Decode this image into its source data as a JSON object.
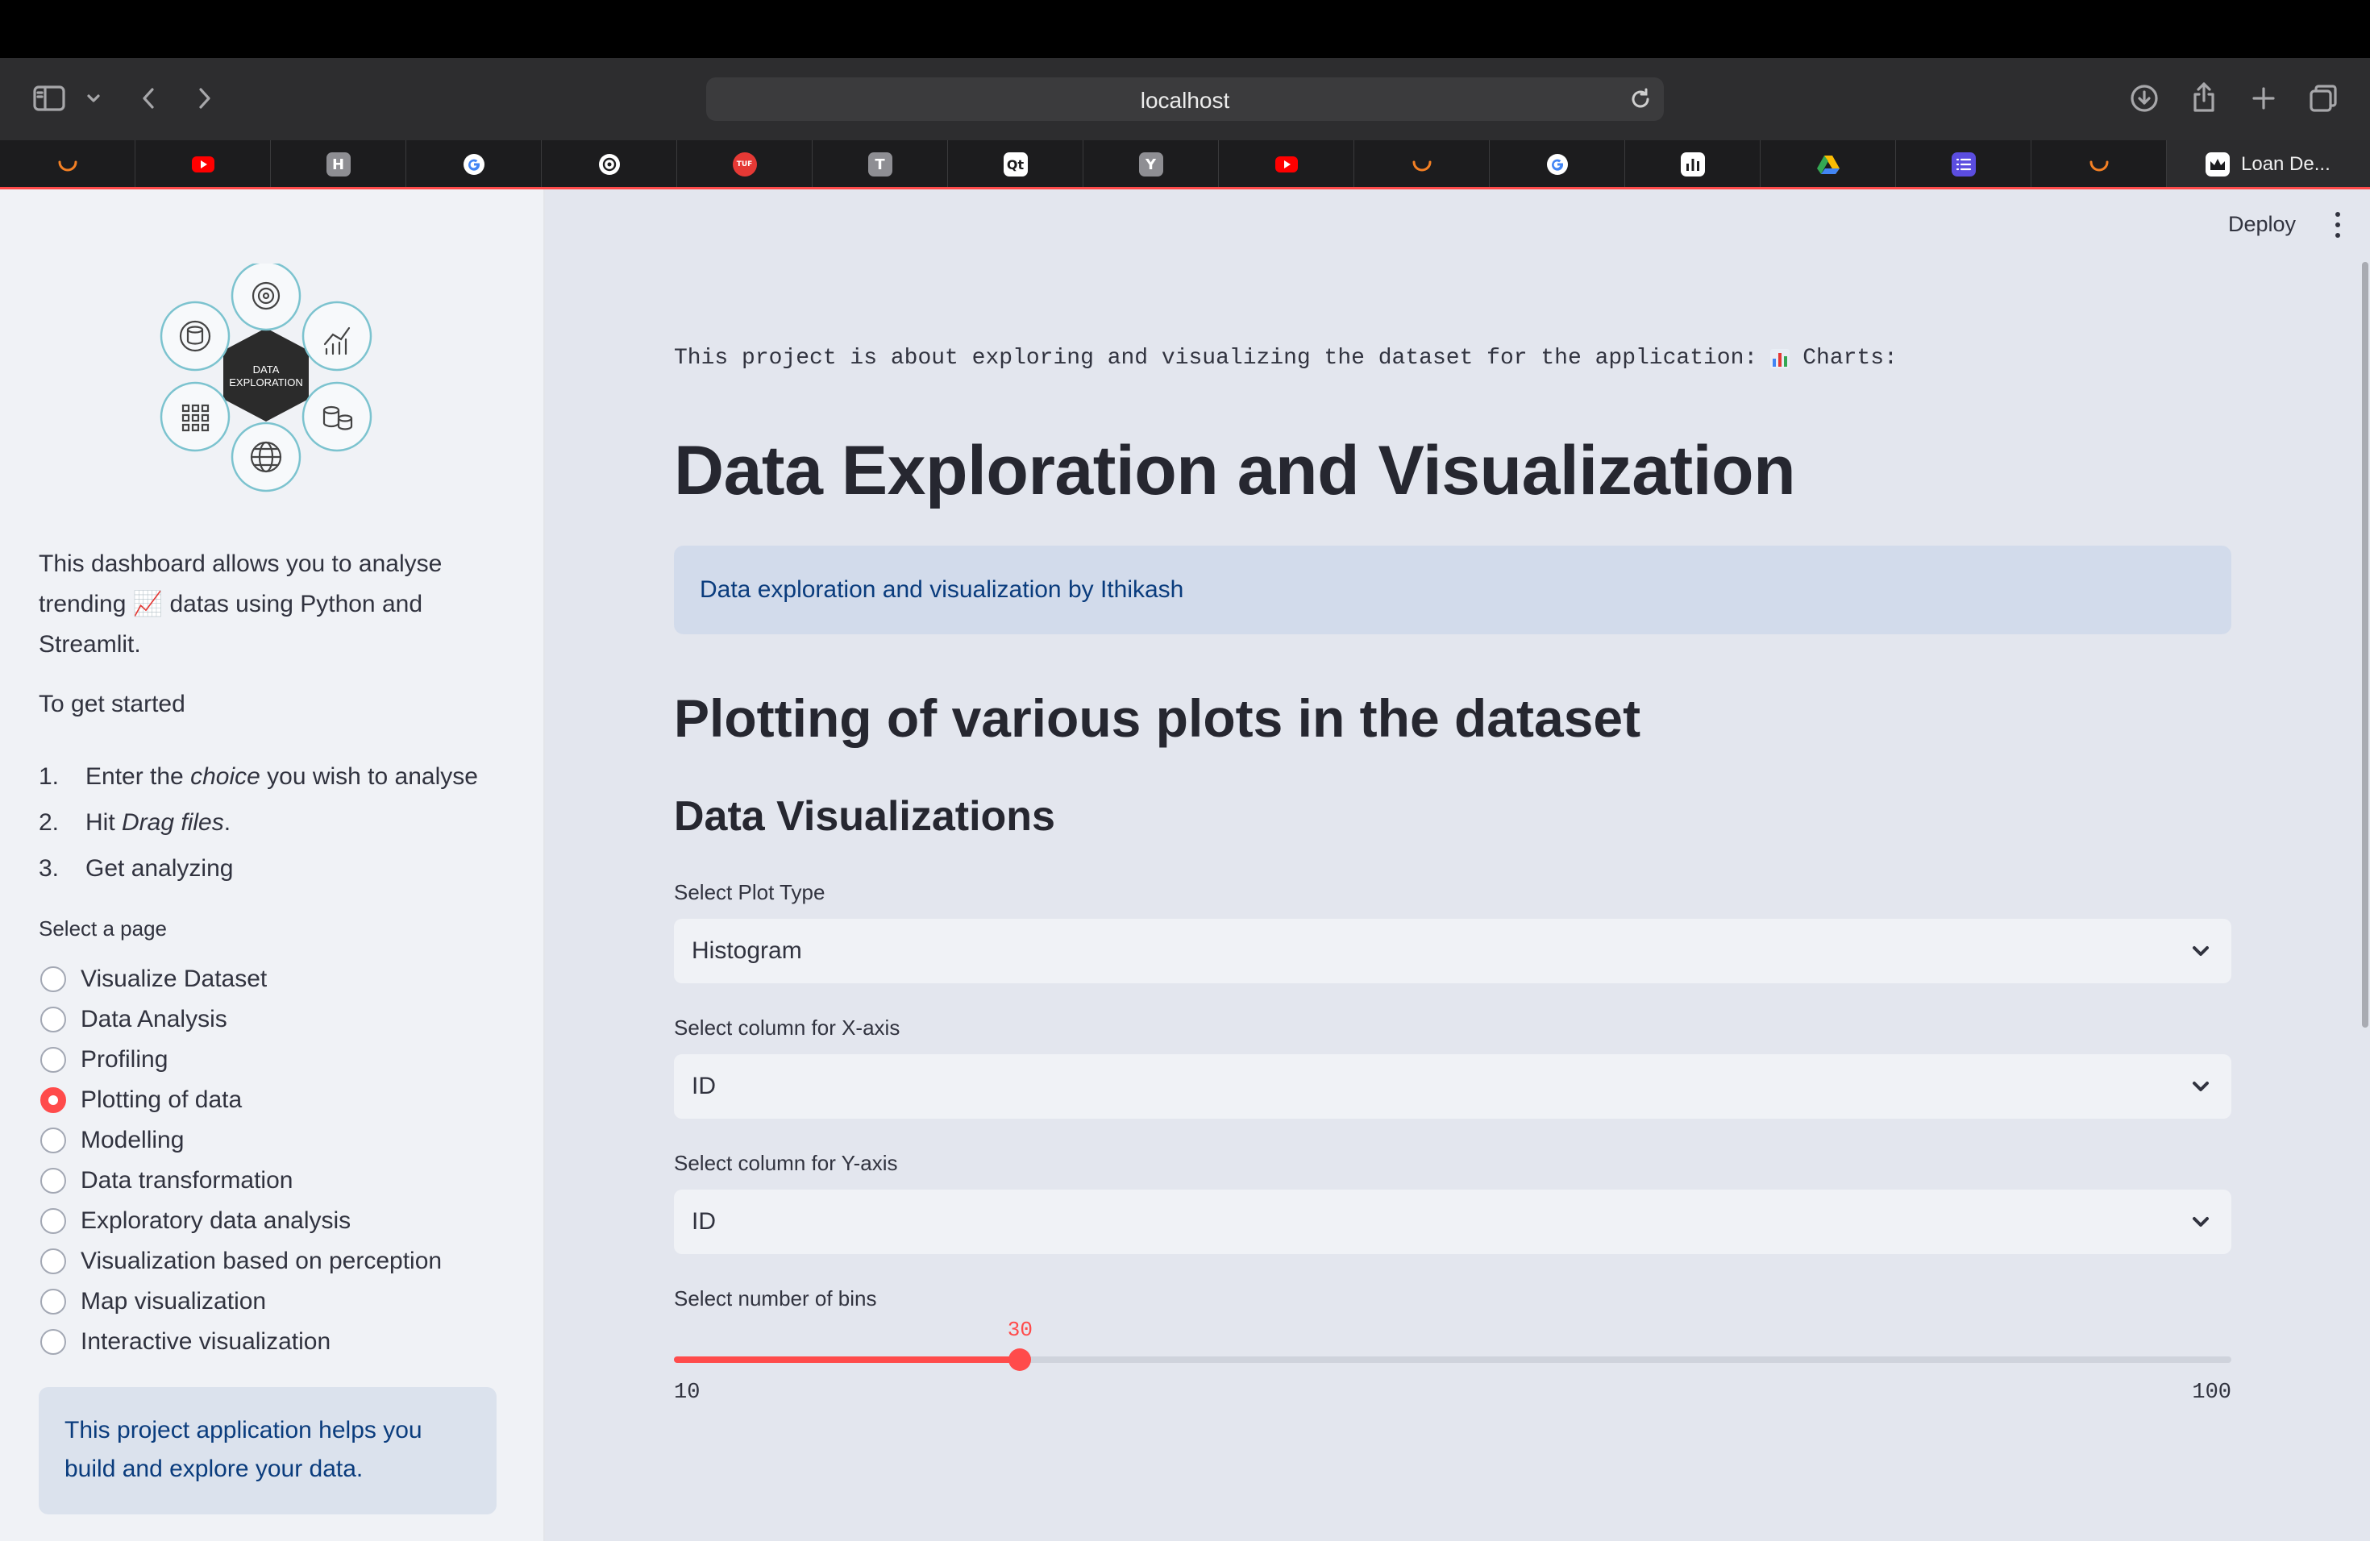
{
  "browser": {
    "url": "localhost",
    "active_tab_title": "Loan De...",
    "tabs": [
      {
        "icon": "loader-icon",
        "color": "#f48024"
      },
      {
        "icon": "youtube-icon",
        "color": "#ff0000"
      },
      {
        "icon": "h-icon",
        "letter": "H",
        "color": "#8e8e93"
      },
      {
        "icon": "google-icon",
        "color": "#4285f4"
      },
      {
        "icon": "openai-icon",
        "color": "#ffffff"
      },
      {
        "icon": "red-circle-icon",
        "letter": "TUF",
        "color": "#e53935"
      },
      {
        "icon": "t-icon",
        "letter": "T",
        "color": "#8e8e93"
      },
      {
        "icon": "qt-icon",
        "letter": "Qt",
        "color": "#ffffff"
      },
      {
        "icon": "y-icon",
        "letter": "Y",
        "color": "#8e8e93"
      },
      {
        "icon": "youtube-icon",
        "color": "#ff0000"
      },
      {
        "icon": "loader-icon",
        "color": "#f48024"
      },
      {
        "icon": "google-icon",
        "color": "#4285f4"
      },
      {
        "icon": "chart-app-icon",
        "color": "#ffffff"
      },
      {
        "icon": "drive-icon",
        "color": "#34a853"
      },
      {
        "icon": "list-app-icon",
        "color": "#5b4de0"
      },
      {
        "icon": "loader-icon",
        "color": "#f48024"
      }
    ]
  },
  "sidebar": {
    "logo_text": [
      "DATA",
      "EXPLORATION"
    ],
    "intro_pre": "This dashboard allows you to analyse trending ",
    "intro_emoji": "📈",
    "intro_post": " datas using Python and Streamlit.",
    "get_started": "To get started",
    "steps": [
      {
        "num": "1.",
        "pre": "Enter the ",
        "em": "choice",
        "post": " you wish to analyse"
      },
      {
        "num": "2.",
        "pre": "Hit ",
        "em": "Drag files",
        "post": "."
      },
      {
        "num": "3.",
        "pre": "Get analyzing",
        "em": "",
        "post": ""
      }
    ],
    "select_page_label": "Select a page",
    "pages": [
      "Visualize Dataset",
      "Data Analysis",
      "Profiling",
      "Plotting of data",
      "Modelling",
      "Data transformation",
      "Exploratory data analysis",
      "Visualization based on perception",
      "Map visualization",
      "Interactive visualization"
    ],
    "selected_page_index": 3,
    "info_text": "This project application helps you build and explore your data."
  },
  "header": {
    "deploy_label": "Deploy"
  },
  "main": {
    "intro_text": "This project is about exploring and visualizing the dataset for the application:",
    "intro_suffix": "Charts:",
    "title": "Data Exploration and Visualization",
    "info_text": "Data exploration and visualization by Ithikash",
    "subtitle": "Plotting of various plots in the dataset",
    "section_title": "Data Visualizations",
    "plot_type_label": "Select Plot Type",
    "plot_type_value": "Histogram",
    "x_axis_label": "Select column for X-axis",
    "x_axis_value": "ID",
    "y_axis_label": "Select column for Y-axis",
    "y_axis_value": "ID",
    "bins_label": "Select number of bins",
    "bins": {
      "value": 30,
      "min": 10,
      "max": 100,
      "value_text": "30",
      "min_text": "10",
      "max_text": "100"
    }
  },
  "colors": {
    "accent": "#ff4b4b",
    "info_text": "#0a3c7d"
  }
}
